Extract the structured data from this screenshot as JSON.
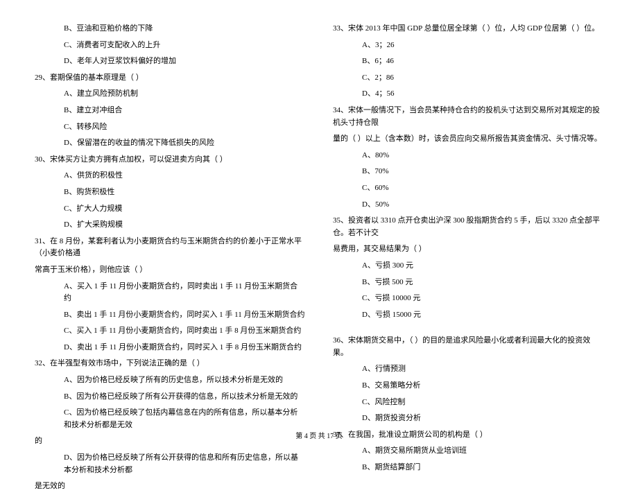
{
  "left": {
    "opts_28": [
      "B、豆油和豆粕价格的下降",
      "C、消费者可支配收入的上升",
      "D、老年人对豆浆饮料偏好的增加"
    ],
    "q29": "29、套期保值的基本原理是（    ）",
    "opts_29": [
      "A、建立风险预防机制",
      "B、建立对冲组合",
      "C、转移风险",
      "D、保留潜在的收益的情况下降低损失的风险"
    ],
    "q30": "30、宋体买方让卖方拥有点加权，可以促进卖方向其（    ）",
    "opts_30": [
      "A、供货的积极性",
      "B、购货积极性",
      "C、扩大人力规模",
      "D、扩大采购规模"
    ],
    "q31_line1": "31、在 8 月份，某套利者认为小麦期货合约与玉米期货合约的价差小于正常水平（小麦价格通",
    "q31_line2": "常高于玉米价格），则他应该（    ）",
    "opts_31": [
      "A、买入 1 手 11 月份小麦期货合约，同时卖出 1 手 11 月份玉米期货合约",
      "B、卖出 1 手 11 月份小麦期货合约，同时买入 1 手 11 月份玉米期货合约",
      "C、买入 1 手 11 月份小麦期货合约，同时卖出 1 手 8 月份玉米期货合约",
      "D、卖出 1 手 11 月份小麦期货合约，同时买入 1 手 8 月份玉米期货合约"
    ],
    "q32": "32、在半强型有效市场中，下列说法正确的是（    ）",
    "opts_32": [
      "A、因为价格已经反映了所有的历史信息，所以技术分析是无效的",
      "B、因为价格已经反映了所有公开获得的信息，所以技术分析是无效的"
    ],
    "opt32c_line1": "C、因为价格已经反映了包括内幕信息在内的所有信息，所以基本分析和技术分析都是无效",
    "opt32c_line2": "的",
    "opt32d_line1": "D、因为价格已经反映了所有公开获得的信息和所有历史信息，所以基本分析和技术分析都",
    "opt32d_line2": "是无效的"
  },
  "right": {
    "q33": "33、宋体 2013 年中国 GDP 总量位居全球第（    ）位，人均 GDP 位居第（    ）位。",
    "opts_33": [
      "A、3；26",
      "B、6；46",
      "C、2；86",
      "D、4；56"
    ],
    "q34_line1": "34、宋体一般情况下，当会员某种持仓合约的投机头寸达到交易所对其规定的投机头寸持仓限",
    "q34_line2": "量的（    ）以上（含本数）时，该会员应向交易所报告其资金情况、头寸情况等。",
    "opts_34": [
      "A、80%",
      "B、70%",
      "C、60%",
      "D、50%"
    ],
    "q35_line1": "35、投资者以 3310 点开仓卖出沪深 300 股指期货合约 5 手，后以 3320 点全部平仓。若不计交",
    "q35_line2": "易费用，其交易结果为（    ）",
    "opts_35": [
      "A、亏损 300 元",
      "B、亏损 500 元",
      "C、亏损 10000 元",
      "D、亏损 15000 元"
    ],
    "q36": "36、宋体期货交易中，（    ）的目的是追求风险最小化或者利润最大化的投资效果。",
    "opts_36": [
      "A、行情预测",
      "B、交易策略分析",
      "C、风险控制",
      "D、期货投资分析"
    ],
    "q37": "37、在我国，批准设立期货公司的机构是（    ）",
    "opts_37": [
      "A、期货交易所期货从业培训班",
      "B、期货结算部门"
    ]
  },
  "footer": "第 4 页 共 17 页"
}
